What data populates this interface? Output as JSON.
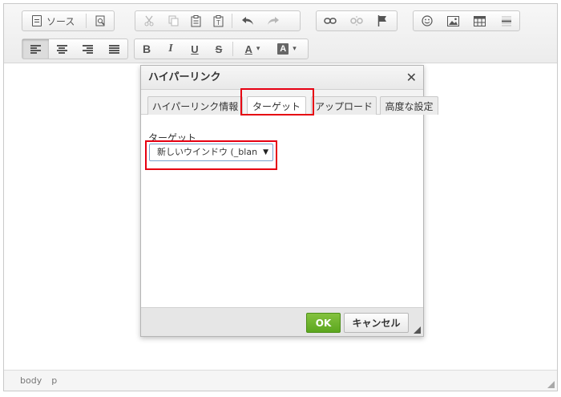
{
  "toolbar": {
    "source_label": "ソース",
    "a_glyph": "A",
    "dropdown_glyph": "▾",
    "bold_glyph": "B",
    "italic_glyph": "I",
    "underline_glyph": "U",
    "strike_glyph": "S"
  },
  "footer": {
    "path": [
      "body",
      "p"
    ]
  },
  "dialog": {
    "title": "ハイパーリンク",
    "close_glyph": "✕",
    "tabs": [
      "ハイパーリンク情報",
      "ターゲット",
      "アップロード",
      "高度な設定"
    ],
    "field_label": "ターゲット",
    "select_value": "新しいウインドウ (_blan",
    "select_arrow": "▼",
    "ok_label": "OK",
    "cancel_label": "キャンセル"
  },
  "colors": {
    "highlight": "#e60012",
    "ok_green": "#6db52d"
  }
}
